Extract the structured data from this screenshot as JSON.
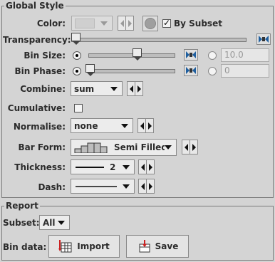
{
  "global_style": {
    "title": "Global Style",
    "color": {
      "label": "Color:",
      "swatch_color": "#c8c8c8",
      "by_subset_label": "By Subset",
      "by_subset_checked": true
    },
    "transparency": {
      "label": "Transparency:",
      "level": 0.0
    },
    "bin_size": {
      "label": "Bin Size:",
      "slider_level": 0.55,
      "radio_slider_selected": true,
      "text_value": "10.0"
    },
    "bin_phase": {
      "label": "Bin Phase:",
      "slider_level": 0.02,
      "radio_slider_selected": true,
      "text_value": "0"
    },
    "combine": {
      "label": "Combine:",
      "value": "sum"
    },
    "cumulative": {
      "label": "Cumulative:",
      "checked": false
    },
    "normalise": {
      "label": "Normalise:",
      "value": "none"
    },
    "bar_form": {
      "label": "Bar Form:",
      "value": "Semi Filled",
      "icon": "semi-filled-bars-icon"
    },
    "thickness": {
      "label": "Thickness:",
      "value": "2",
      "icon": "line-sample-icon"
    },
    "dash": {
      "label": "Dash:",
      "icon": "solid-line-icon"
    }
  },
  "report": {
    "title": "Report",
    "subset": {
      "label": "Subset:",
      "value": "All"
    },
    "bin_data": {
      "label": "Bin data:"
    },
    "import_button": {
      "label": "Import",
      "icon": "import-table-icon"
    },
    "save_button": {
      "label": "Save",
      "icon": "save-table-icon"
    }
  },
  "colors": {
    "background": "#d4d4d4",
    "accent_icon": "#1f5f9f",
    "icon_red": "#cc2222"
  }
}
